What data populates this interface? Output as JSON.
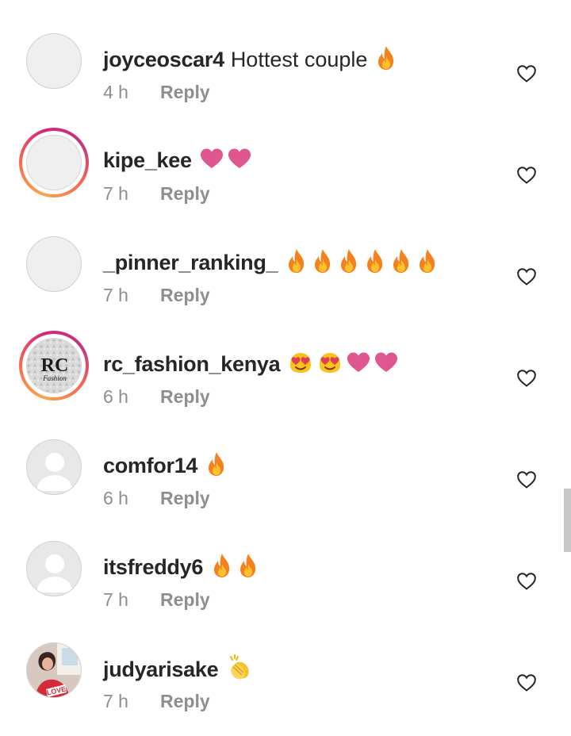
{
  "comments": [
    {
      "username": "joyceoscar4",
      "text": "Hottest couple",
      "emojis": [
        "fire"
      ],
      "time": "4 h",
      "reply_label": "Reply",
      "avatar": "blank",
      "story_ring": false
    },
    {
      "username": "kipe_kee",
      "text": "",
      "emojis": [
        "pink-heart",
        "pink-heart"
      ],
      "time": "7 h",
      "reply_label": "Reply",
      "avatar": "blank",
      "story_ring": true
    },
    {
      "username": "_pinner_ranking_",
      "text": "",
      "emojis": [
        "fire",
        "fire",
        "fire",
        "fire",
        "fire",
        "fire"
      ],
      "time": "7 h",
      "reply_label": "Reply",
      "avatar": "blank",
      "story_ring": false
    },
    {
      "username": "rc_fashion_kenya",
      "text": "",
      "emojis": [
        "heart-eyes",
        "heart-eyes",
        "pink-heart",
        "pink-heart"
      ],
      "time": "6 h",
      "reply_label": "Reply",
      "avatar": "rc-logo",
      "story_ring": true,
      "avatar_logo_text": "RC",
      "avatar_logo_subtext": "Fashion"
    },
    {
      "username": "comfor14",
      "text": "",
      "emojis": [
        "fire"
      ],
      "time": "6 h",
      "reply_label": "Reply",
      "avatar": "default-person",
      "story_ring": false
    },
    {
      "username": "itsfreddy6",
      "text": "",
      "emojis": [
        "fire",
        "fire"
      ],
      "time": "7 h",
      "reply_label": "Reply",
      "avatar": "default-person",
      "story_ring": false
    },
    {
      "username": "judyarisake",
      "text": "",
      "emojis": [
        "clapping-hands"
      ],
      "time": "7 h",
      "reply_label": "Reply",
      "avatar": "photo",
      "story_ring": false
    }
  ],
  "colors": {
    "text": "#262626",
    "meta": "#8e8e8e",
    "fire": "#f58a1f",
    "heart": "#e0568f",
    "story_ring": "#d4247a"
  },
  "like_icon": "heart-outline-icon"
}
